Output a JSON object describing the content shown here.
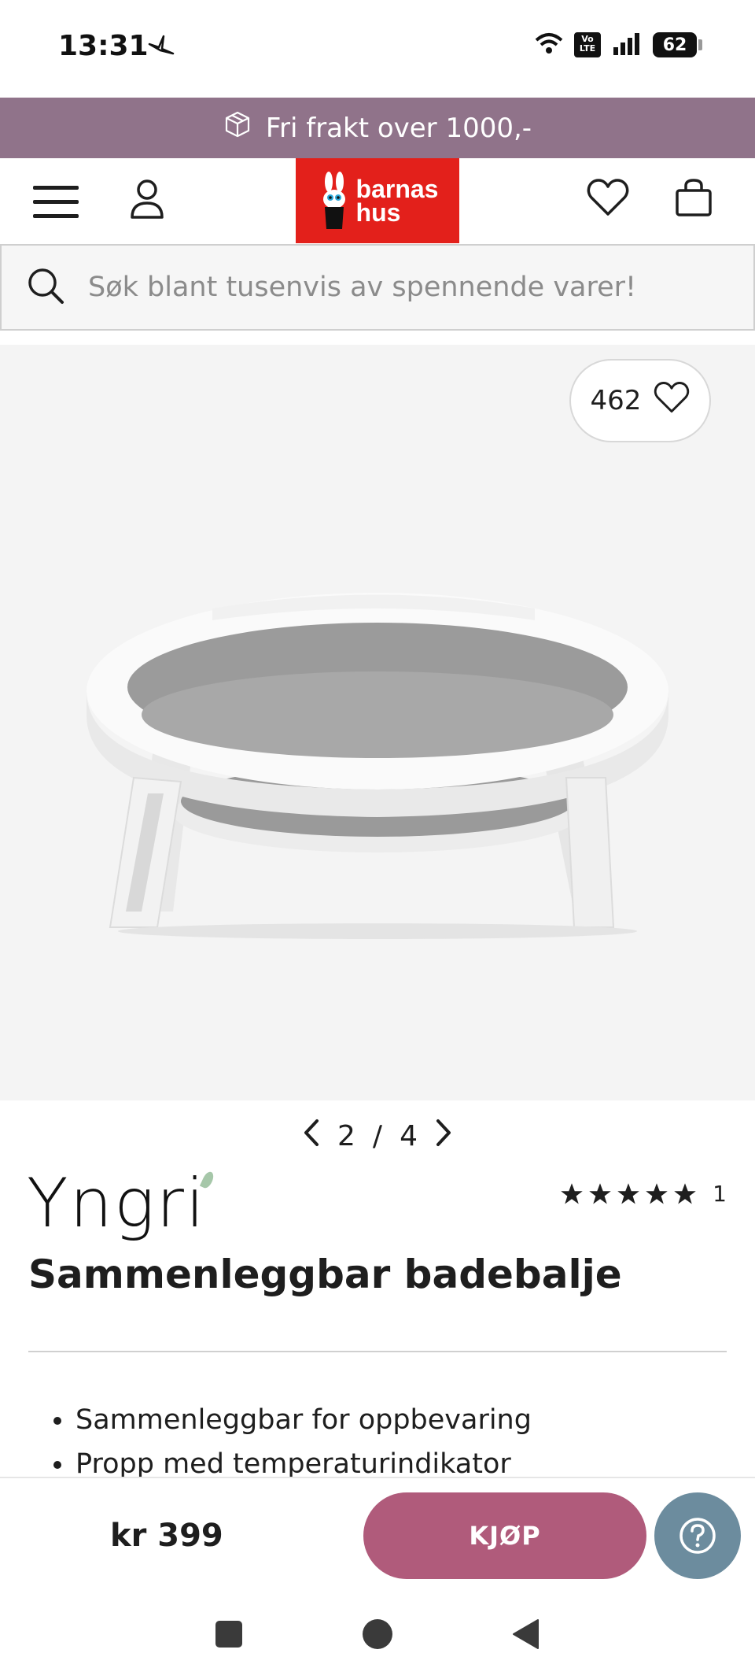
{
  "status_bar": {
    "time": "13:31",
    "volte": "Vo LTE",
    "battery": "62"
  },
  "promo": {
    "text": "Fri frakt over 1000,-",
    "icon": "box-icon"
  },
  "header": {
    "logo_line1": "barnas",
    "logo_line2": "hus",
    "icons": [
      "menu-icon",
      "account-icon",
      "heart-icon",
      "shopping-bag-icon"
    ]
  },
  "search": {
    "placeholder": "Søk blant tusenvis av spennende varer!"
  },
  "gallery": {
    "likes": "462",
    "current": "2",
    "separator": "/",
    "total": "4"
  },
  "product": {
    "brand": "Yngri",
    "rating_count": "1",
    "rating_stars": 5,
    "title": "Sammenleggbar badebalje",
    "features": [
      "Sammenleggbar for oppbevaring",
      "Propp med temperaturindikator"
    ]
  },
  "buy_bar": {
    "price": "kr 399",
    "buy_label": "KJØP"
  },
  "colors": {
    "promo_bg": "#90738a",
    "logo_red": "#e3201b",
    "buy_button": "#b05b7b",
    "help_button": "#6c8c9e"
  }
}
